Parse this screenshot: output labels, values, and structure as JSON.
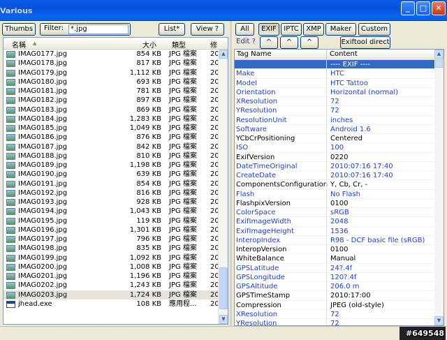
{
  "window": {
    "title": "Various",
    "minimize_glyph": "_",
    "maximize_glyph": "□",
    "close_glyph": "✕"
  },
  "toolbar": {
    "thumbs": "Thumbs",
    "filter_label": "Filter:",
    "filter_value": "*.jpg",
    "list": "List*",
    "view": "View ?",
    "all": "All",
    "exif": "EXIF",
    "iptc": "IPTC",
    "xmp": "XMP",
    "maker": "Maker",
    "custom": "Custom",
    "edit": "Edit ?",
    "nav1": "^",
    "nav2": "^",
    "nav3": "^",
    "exiftool": "Exiftool direct"
  },
  "file_list": {
    "headers": {
      "name": "名稱",
      "size": "大小",
      "type": "類型",
      "date": "修"
    },
    "rows": [
      {
        "name": "IMAG0177.jpg",
        "size": "854 KB",
        "type": "JPG 檔案",
        "date": "20"
      },
      {
        "name": "IMAG0178.jpg",
        "size": "817 KB",
        "type": "JPG 檔案",
        "date": "20"
      },
      {
        "name": "IMAG0179.jpg",
        "size": "1,112 KB",
        "type": "JPG 檔案",
        "date": "20"
      },
      {
        "name": "IMAG0180.jpg",
        "size": "693 KB",
        "type": "JPG 檔案",
        "date": "20"
      },
      {
        "name": "IMAG0181.jpg",
        "size": "781 KB",
        "type": "JPG 檔案",
        "date": "20"
      },
      {
        "name": "IMAG0182.jpg",
        "size": "897 KB",
        "type": "JPG 檔案",
        "date": "20"
      },
      {
        "name": "IMAG0183.jpg",
        "size": "869 KB",
        "type": "JPG 檔案",
        "date": "20"
      },
      {
        "name": "IMAG0184.jpg",
        "size": "1,283 KB",
        "type": "JPG 檔案",
        "date": "20"
      },
      {
        "name": "IMAG0185.jpg",
        "size": "1,049 KB",
        "type": "JPG 檔案",
        "date": "20"
      },
      {
        "name": "IMAG0186.jpg",
        "size": "876 KB",
        "type": "JPG 檔案",
        "date": "20"
      },
      {
        "name": "IMAG0187.jpg",
        "size": "842 KB",
        "type": "JPG 檔案",
        "date": "20"
      },
      {
        "name": "IMAG0188.jpg",
        "size": "810 KB",
        "type": "JPG 檔案",
        "date": "20"
      },
      {
        "name": "IMAG0189.jpg",
        "size": "1,198 KB",
        "type": "JPG 檔案",
        "date": "20"
      },
      {
        "name": "IMAG0190.jpg",
        "size": "639 KB",
        "type": "JPG 檔案",
        "date": "20"
      },
      {
        "name": "IMAG0191.jpg",
        "size": "854 KB",
        "type": "JPG 檔案",
        "date": "20"
      },
      {
        "name": "IMAG0192.jpg",
        "size": "816 KB",
        "type": "JPG 檔案",
        "date": "20"
      },
      {
        "name": "IMAG0193.jpg",
        "size": "928 KB",
        "type": "JPG 檔案",
        "date": "20"
      },
      {
        "name": "IMAG0194.jpg",
        "size": "1,043 KB",
        "type": "JPG 檔案",
        "date": "20"
      },
      {
        "name": "IMAG0195.jpg",
        "size": "119 KB",
        "type": "JPG 檔案",
        "date": "20"
      },
      {
        "name": "IMAG0196.jpg",
        "size": "1,301 KB",
        "type": "JPG 檔案",
        "date": "20"
      },
      {
        "name": "IMAG0197.jpg",
        "size": "796 KB",
        "type": "JPG 檔案",
        "date": "20"
      },
      {
        "name": "IMAG0198.jpg",
        "size": "835 KB",
        "type": "JPG 檔案",
        "date": "20"
      },
      {
        "name": "IMAG0199.jpg",
        "size": "1,092 KB",
        "type": "JPG 檔案",
        "date": "20"
      },
      {
        "name": "IMAG0200.jpg",
        "size": "1,008 KB",
        "type": "JPG 檔案",
        "date": "20"
      },
      {
        "name": "IMAG0201.jpg",
        "size": "1,196 KB",
        "type": "JPG 檔案",
        "date": "20"
      },
      {
        "name": "IMAG0202.jpg",
        "size": "1,243 KB",
        "type": "JPG 檔案",
        "date": "20"
      },
      {
        "name": "IMAG0203.jpg",
        "size": "1,724 KB",
        "type": "JPG 檔案",
        "date": "20"
      },
      {
        "name": "jhead.exe",
        "size": "108 KB",
        "type": "應用程...",
        "date": "20"
      }
    ]
  },
  "tag_table": {
    "headers": {
      "tag": "Tag Name",
      "content": "Content"
    },
    "rows": [
      {
        "tag": "",
        "content": "---- EXIF ----"
      },
      {
        "tag": "Make",
        "content": "HTC"
      },
      {
        "tag": "Model",
        "content": "HTC Tattoo"
      },
      {
        "tag": "Orientation",
        "content": "Horizontal (normal)"
      },
      {
        "tag": "XResolution",
        "content": "72"
      },
      {
        "tag": "YResolution",
        "content": "72"
      },
      {
        "tag": "ResolutionUnit",
        "content": "inches"
      },
      {
        "tag": "Software",
        "content": "Android 1.6"
      },
      {
        "tag": "YCbCrPositioning",
        "content": "Centered"
      },
      {
        "tag": "ISO",
        "content": "100"
      },
      {
        "tag": "ExifVersion",
        "content": "0220"
      },
      {
        "tag": "DateTimeOriginal",
        "content": "2010:07:16 17:40"
      },
      {
        "tag": "CreateDate",
        "content": "2010:07:16 17:40"
      },
      {
        "tag": "ComponentsConfiguration",
        "content": "Y, Cb, Cr, -"
      },
      {
        "tag": "Flash",
        "content": "No Flash"
      },
      {
        "tag": "FlashpixVersion",
        "content": "0100"
      },
      {
        "tag": "ColorSpace",
        "content": "sRGB"
      },
      {
        "tag": "ExifImageWidth",
        "content": "2048"
      },
      {
        "tag": "ExifImageHeight",
        "content": "1536"
      },
      {
        "tag": "InteropIndex",
        "content": "R98 - DCF basic file (sRGB)"
      },
      {
        "tag": "InteropVersion",
        "content": "0100"
      },
      {
        "tag": "WhiteBalance",
        "content": "Manual"
      },
      {
        "tag": "GPSLatitude",
        "content": "24?.4f"
      },
      {
        "tag": "GPSLongitude",
        "content": "120?.4f"
      },
      {
        "tag": "GPSAltitude",
        "content": "206.0 m"
      },
      {
        "tag": "GPSTimeStamp",
        "content": "2010:17:00"
      },
      {
        "tag": "Compression",
        "content": "JPEG (old-style)"
      },
      {
        "tag": "XResolution",
        "content": "72"
      },
      {
        "tag": "YResolution",
        "content": "72"
      }
    ]
  },
  "watermark": "#649548",
  "colors": {
    "accent": "#3169c6",
    "tag_link": "#1e40c8",
    "titlebar": "#0453d9"
  }
}
